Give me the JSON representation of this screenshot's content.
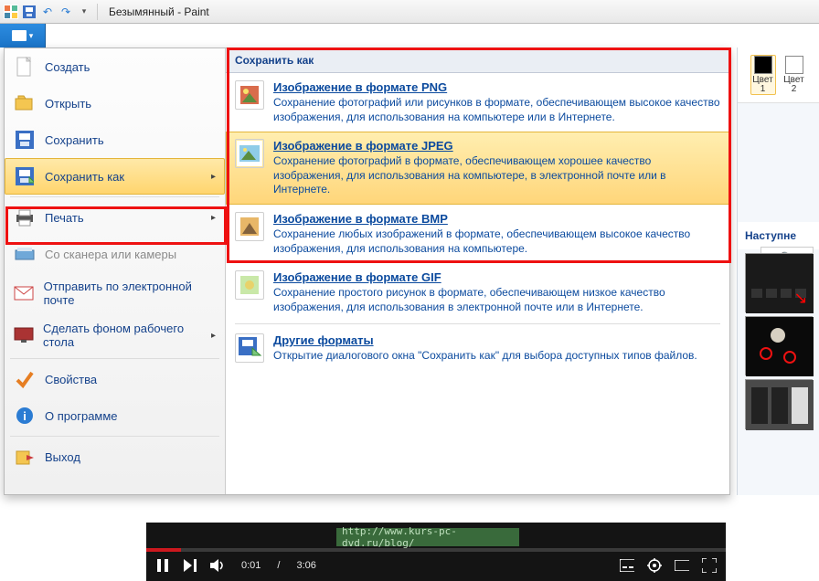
{
  "window": {
    "title": "Безымянный - Paint"
  },
  "menu": {
    "create": "Создать",
    "open": "Открыть",
    "save": "Сохранить",
    "saveas": "Сохранить как",
    "print": "Печать",
    "scanner": "Со сканера или камеры",
    "email": "Отправить по электронной почте",
    "wallpaper": "Сделать фоном рабочего стола",
    "properties": "Свойства",
    "about": "О программе",
    "exit": "Выход"
  },
  "saveas": {
    "header": "Сохранить как",
    "formats": [
      {
        "title": "Изображение в формате PNG",
        "desc": "Сохранение фотографий или рисунков в формате, обеспечивающем высокое качество изображения, для использования на компьютере или в Интернете."
      },
      {
        "title": "Изображение в формате JPEG",
        "desc": "Сохранение фотографий в формате, обеспечивающем хорошее качество изображения, для использования на компьютере, в электронной почте или в Интернете."
      },
      {
        "title": "Изображение в формате BMP",
        "desc": "Сохранение любых изображений в формате, обеспечивающем высокое качество изображения, для использования на компьютере."
      },
      {
        "title": "Изображение в формате GIF",
        "desc": "Сохранение простого рисунок в формате, обеспечивающем низкое качество изображения, для использования в электронной почте или в Интернете."
      },
      {
        "title": "Другие форматы",
        "desc": "Открытие диалогового окна \"Сохранить как\" для выбора доступных типов файлов."
      }
    ]
  },
  "colors": {
    "c1": {
      "label": "Цвет 1",
      "hex": "#000000"
    },
    "c2": {
      "label": "Цвет 2",
      "hex": "#ffffff"
    }
  },
  "right": {
    "next_label": "Наступне"
  },
  "video": {
    "url": "http://www.kurs-pc-dvd.ru/blog/",
    "current": "0:01",
    "total": "3:06"
  }
}
